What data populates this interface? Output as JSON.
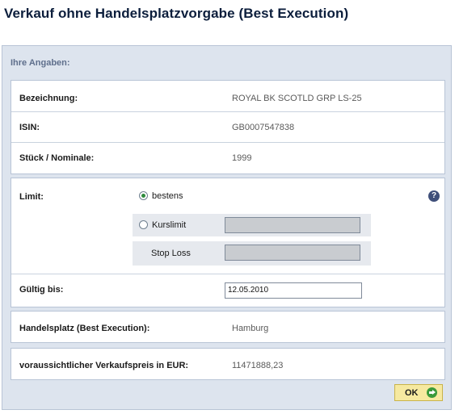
{
  "title": "Verkauf ohne Handelsplatzvorgabe (Best Execution)",
  "section_title": "Ihre Angaben:",
  "fields": {
    "bezeichnung": {
      "label": "Bezeichnung:",
      "value": "ROYAL BK SCOTLD GRP LS-25"
    },
    "isin": {
      "label": "ISIN:",
      "value": "GB0007547838"
    },
    "stueck": {
      "label": "Stück / Nominale:",
      "value": "1999"
    }
  },
  "limit": {
    "label": "Limit:",
    "options": {
      "bestens": {
        "label": "bestens",
        "selected": true
      },
      "kurslimit": {
        "label": "Kurslimit",
        "selected": false
      }
    },
    "stop_loss_label": "Stop Loss",
    "kurslimit_value": "",
    "stop_loss_value": ""
  },
  "gueltig": {
    "label": "Gültig bis:",
    "value": "12.05.2010"
  },
  "handelsplatz": {
    "label": "Handelsplatz (Best Execution):",
    "value": "Hamburg"
  },
  "verkaufspreis": {
    "label": "voraussichtlicher Verkaufspreis in EUR:",
    "value": "11471888,23"
  },
  "help_icon": "question-mark",
  "ok_button": {
    "label": "OK",
    "icon": "arrow-right-circle"
  },
  "colors": {
    "title": "#0c1e3c",
    "panel_bg": "#dde4ee",
    "section_title": "#5f6f8c",
    "ok_bg": "#f6e9a0",
    "radio_selected": "#2e8b3c"
  }
}
